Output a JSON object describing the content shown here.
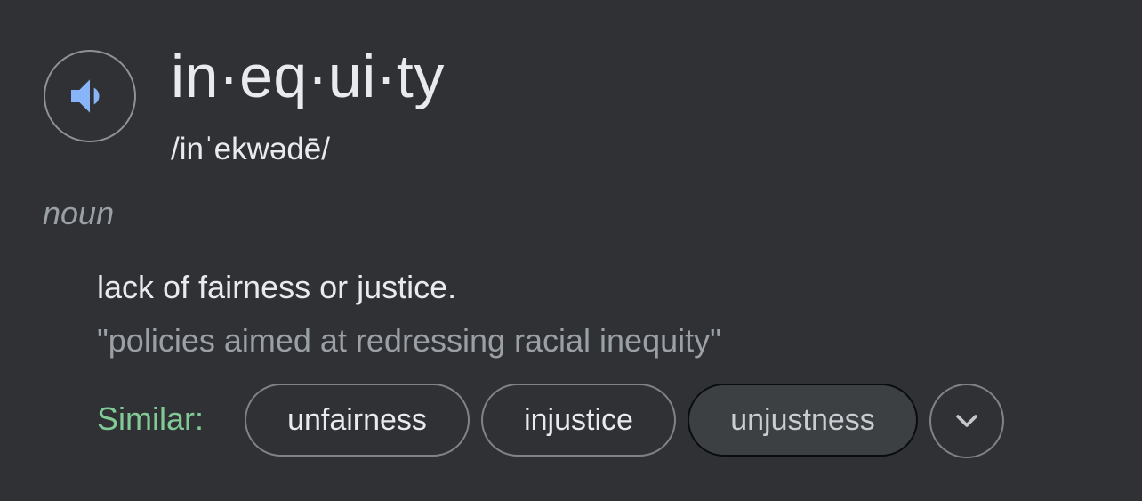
{
  "entry": {
    "headword": "in·eq·ui·ty",
    "phonetic": "/inˈekwədē/",
    "part_of_speech": "noun",
    "definition": "lack of fairness or justice.",
    "example": "\"policies aimed at redressing racial inequity\""
  },
  "similar": {
    "label": "Similar:",
    "chips": [
      "unfairness",
      "injustice",
      "unjustness"
    ]
  },
  "icons": {
    "speaker": "speaker-icon",
    "expand": "chevron-down-icon"
  },
  "colors": {
    "background": "#303134",
    "speaker_blue": "#8ab4f8",
    "similar_green": "#81c995",
    "primary_text": "#e8eaed",
    "secondary_text": "#9aa0a6"
  }
}
